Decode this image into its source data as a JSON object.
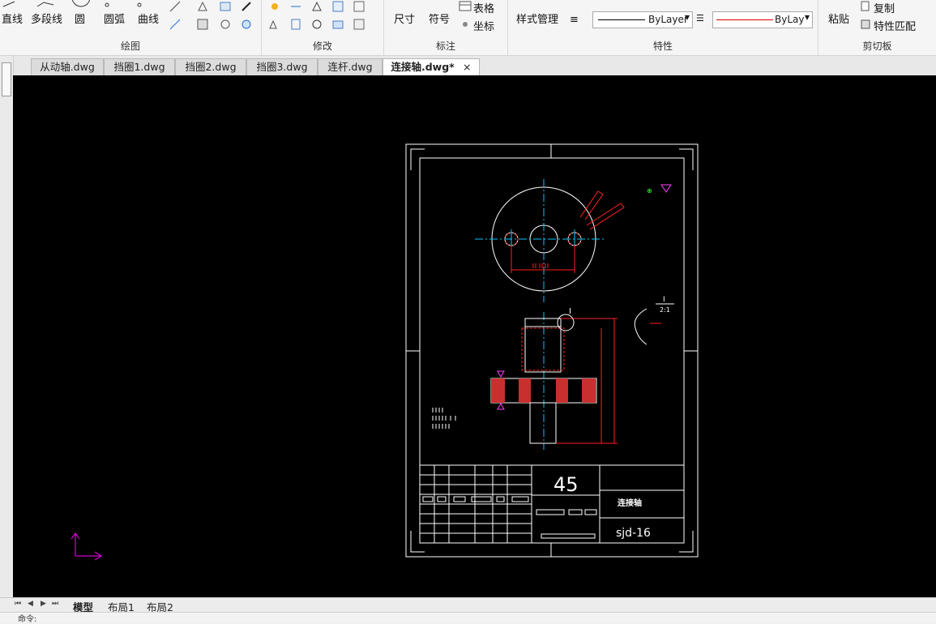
{
  "ribbon": {
    "draw_group": {
      "label": "绘图",
      "line": "直线",
      "polyline": "多段线",
      "circle": "圆",
      "arc": "圆弧",
      "curve": "曲线"
    },
    "modify_group": {
      "label": "修改"
    },
    "annotate_group": {
      "label": "标注",
      "dimension": "尺寸",
      "symbol": "符号",
      "table": "表格",
      "coordinate": "坐标"
    },
    "properties_group": {
      "label": "特性",
      "style_manager": "样式管理",
      "linetype": "ByLayer",
      "color_layer": "ByLay"
    },
    "clipboard_group": {
      "label": "剪切板",
      "paste": "粘贴",
      "copy": "复制",
      "match_props": "特性匹配"
    }
  },
  "tabs": [
    {
      "label": "从动轴.dwg",
      "active": false
    },
    {
      "label": "挡圈1.dwg",
      "active": false
    },
    {
      "label": "挡圈2.dwg",
      "active": false
    },
    {
      "label": "挡圈3.dwg",
      "active": false
    },
    {
      "label": "连杆.dwg",
      "active": false
    },
    {
      "label": "连接轴.dwg*",
      "active": true
    }
  ],
  "close_glyph": "×",
  "drawing": {
    "material": "45",
    "part_name": "连接轴",
    "drawing_no": "sjd-16",
    "detail_label": "I",
    "detail_scale": "2:1"
  },
  "layouts": [
    {
      "label": "模型",
      "active": true
    },
    {
      "label": "布局1",
      "active": false
    },
    {
      "label": "布局2",
      "active": false
    }
  ],
  "command_prompt": "命令:",
  "colors": {
    "canvas": "#000000",
    "paper": "#ffffff",
    "centerline": "#00c8ff",
    "dimension": "#ff2020",
    "ucs": "#ff00ff"
  }
}
